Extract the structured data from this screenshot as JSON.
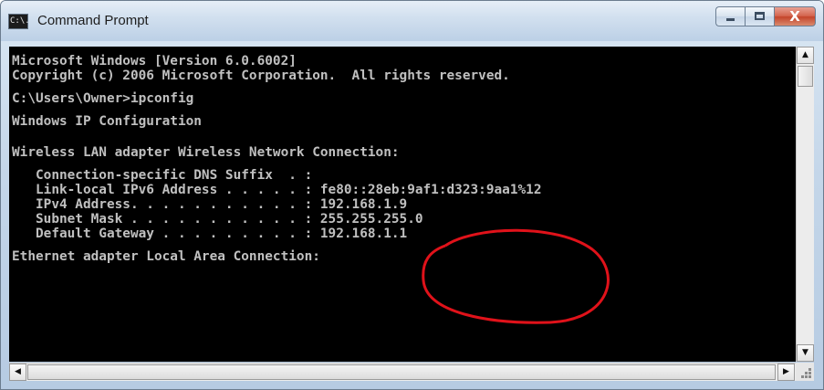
{
  "window": {
    "title": "Command Prompt",
    "icon_label": "C:\\."
  },
  "console": {
    "lines": [
      "Microsoft Windows [Version 6.0.6002]",
      "Copyright (c) 2006 Microsoft Corporation.  All rights reserved.",
      "",
      "C:\\Users\\Owner>ipconfig",
      "",
      "Windows IP Configuration",
      "",
      "",
      "Wireless LAN adapter Wireless Network Connection:",
      "",
      "   Connection-specific DNS Suffix  . :",
      "   Link-local IPv6 Address . . . . . : fe80::28eb:9af1:d323:9aa1%12",
      "   IPv4 Address. . . . . . . . . . . : 192.168.1.9",
      "   Subnet Mask . . . . . . . . . . . : 255.255.255.0",
      "   Default Gateway . . . . . . . . . : 192.168.1.1",
      "",
      "Ethernet adapter Local Area Connection:"
    ],
    "text_color": "#c0c0c0",
    "background": "#000000"
  },
  "annotation": {
    "shape": "ellipse",
    "color": "#e0121a",
    "encircled": [
      "192.168.1.9",
      "255.255.255.0",
      "192.168.1.1"
    ]
  },
  "controls": {
    "minimize_icon": "minimize-icon",
    "maximize_icon": "maximize-icon",
    "close_icon": "close-icon",
    "close_glyph": "X",
    "scroll_up_glyph": "▲",
    "scroll_down_glyph": "▼",
    "scroll_left_glyph": "◀",
    "scroll_right_glyph": "▶",
    "close_color": "#c8432b"
  }
}
